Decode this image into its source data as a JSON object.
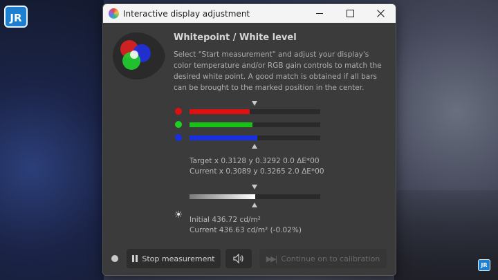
{
  "watermark": {
    "logo_text": "JR"
  },
  "window": {
    "title": "Interactive display adjustment",
    "heading": "Whitepoint / White level",
    "description": "Select \"Start measurement\" and adjust your display's color temperature and/or RGB gain controls to match the desired white point. A good match is obtained if all bars can be brought to the marked position in the center."
  },
  "rgb_bars": [
    {
      "name": "red",
      "color": "#e01010",
      "fill_fraction": 0.46
    },
    {
      "name": "green",
      "color": "#18c018",
      "fill_fraction": 0.48
    },
    {
      "name": "blue",
      "color": "#1a2fe0",
      "fill_fraction": 0.52
    }
  ],
  "whitepoint_readout": {
    "target": "Target x 0.3128 y 0.3292 0.0 ΔE*00",
    "current": "Current x 0.3089 y 0.3265 2.0 ΔE*00"
  },
  "luminance": {
    "fill_fraction": 0.5,
    "initial": "Initial 436.72 cd/m²",
    "current": "Current 436.63 cd/m² (-0.02%)"
  },
  "buttons": {
    "stop_label": "Stop measurement",
    "continue_label": "Continue on to calibration"
  },
  "icons": {
    "app": "app-icon",
    "sun": "brightness-icon",
    "sound": "speaker-icon",
    "pause": "pause-icon",
    "skip": "skip-forward-icon"
  }
}
